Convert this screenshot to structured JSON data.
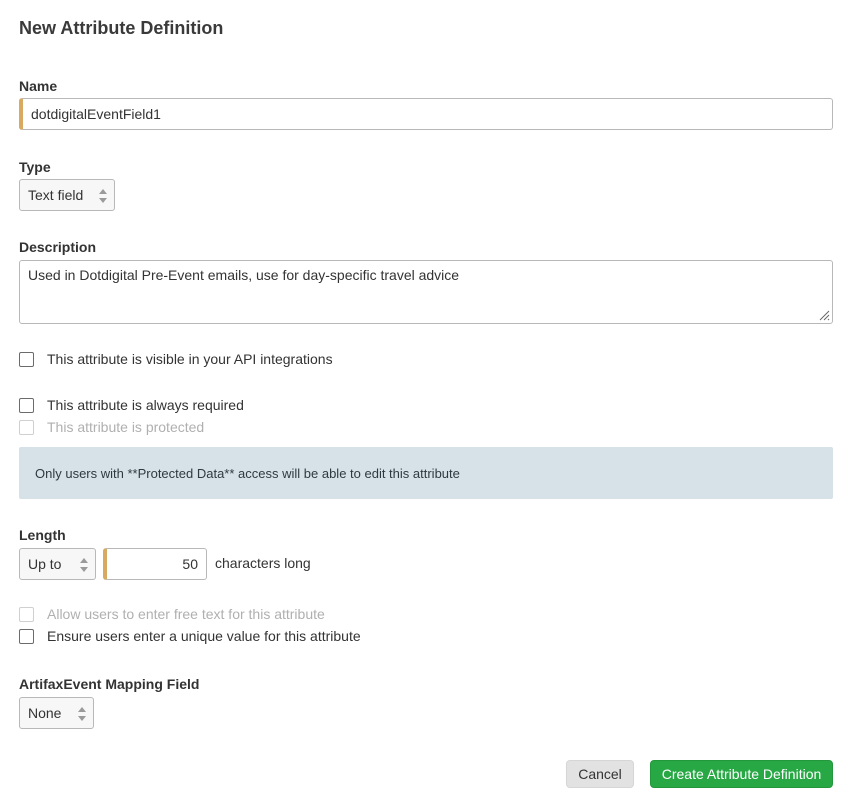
{
  "dialog": {
    "title": "New Attribute Definition"
  },
  "name": {
    "label": "Name",
    "value": "dotdigitalEventField1"
  },
  "type": {
    "label": "Type",
    "selected": "Text field"
  },
  "description": {
    "label": "Description",
    "value": "Used in Dotdigital Pre-Event emails, use for day-specific travel advice"
  },
  "options": {
    "api_visible": "This attribute is visible in your API integrations",
    "always_required": "This attribute is always required",
    "protected": "This attribute is protected"
  },
  "info_banner": {
    "text": "Only users with **Protected Data** access will be able to edit this attribute"
  },
  "length": {
    "label": "Length",
    "qualifier": "Up to",
    "value": "50",
    "suffix": "characters long"
  },
  "options2": {
    "free_text": "Allow users to enter free text for this attribute",
    "unique_value": "Ensure users enter a unique value for this attribute"
  },
  "mapping": {
    "label": "ArtifaxEvent Mapping Field",
    "selected": "None"
  },
  "buttons": {
    "cancel": "Cancel",
    "create": "Create Attribute Definition"
  },
  "colors": {
    "accent_input_border": "#d8a960",
    "banner_bg": "#d6e2e8",
    "primary_button": "#27a844"
  }
}
